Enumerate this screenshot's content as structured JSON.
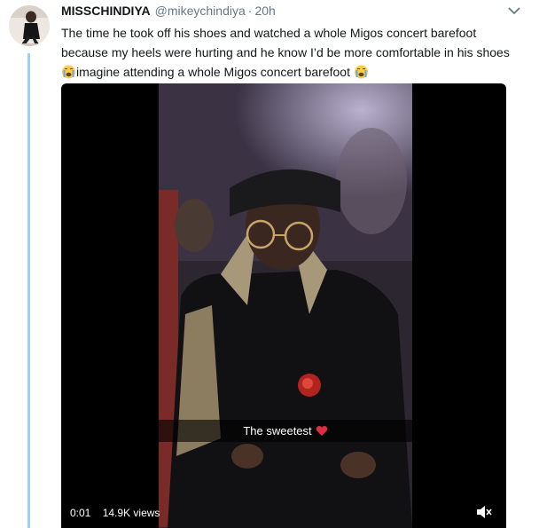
{
  "tweet": {
    "display_name": "MISSCHINDIYA",
    "handle": "@mikeychindiya",
    "separator": "·",
    "time": "20h",
    "text_line1": "The time he took off his shoes and watched a whole Migos concert barefoot",
    "text_line2": "because my heels were hurting and he know I’d be more comfortable in his shoes",
    "text_line3": "imagine attending a whole Migos concert barefoot",
    "emoji": "loudly-crying-face"
  },
  "video": {
    "caption": "The sweetest",
    "caption_emoji": "red-heart",
    "elapsed": "0:01",
    "views": "14.9K views",
    "sound_icon": "speaker-muted-icon"
  },
  "colors": {
    "thread_line": "#9fd0f0",
    "secondary_text": "#657786",
    "primary_text": "#14171a"
  }
}
